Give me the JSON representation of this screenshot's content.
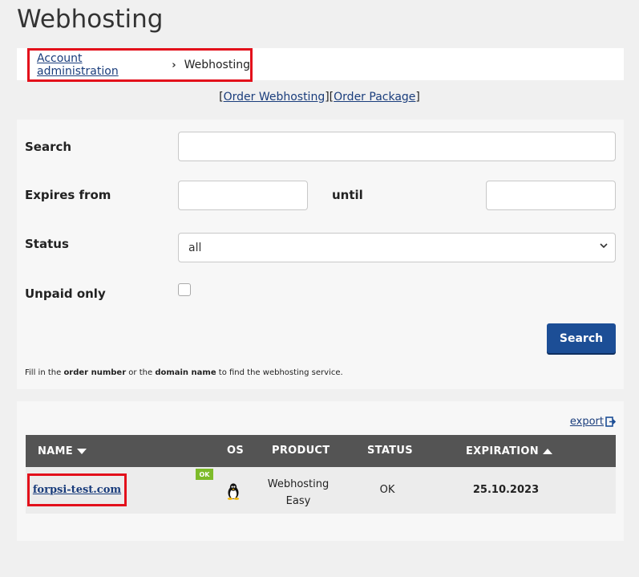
{
  "page": {
    "title": "Webhosting"
  },
  "breadcrumb": {
    "parent": "Account administration",
    "separator": "›",
    "current": "Webhosting"
  },
  "order_links": {
    "open1": "[",
    "order_webhosting": "Order Webhosting",
    "mid": "][",
    "order_package": "Order Package",
    "close": "]"
  },
  "filter": {
    "search_label": "Search",
    "search_value": "",
    "expires_from_label": "Expires from",
    "expires_from_value": "",
    "until_label": "until",
    "until_value": "",
    "status_label": "Status",
    "status_selected": "all",
    "unpaid_label": "Unpaid only",
    "unpaid_checked": false,
    "search_button": "Search",
    "hint_pre": "Fill in the ",
    "hint_b1": "order number",
    "hint_mid": " or the ",
    "hint_b2": "domain name",
    "hint_post": " to find the webhosting service."
  },
  "results": {
    "export_label": "export",
    "columns": {
      "name": "NAME",
      "os": "OS",
      "product": "PRODUCT",
      "status": "STATUS",
      "expiration": "EXPIRATION"
    },
    "rows": [
      {
        "name": "forpsi-test.com",
        "badge": "OK",
        "os_icon": "linux-tux-icon",
        "product_line1": "Webhosting",
        "product_line2": "Easy",
        "status": "OK",
        "expiration": "25.10.2023"
      }
    ]
  },
  "colors": {
    "accent": "#1c4e96",
    "highlight": "#e3101b",
    "header_bg": "#545454",
    "ok_badge": "#7dbb2a"
  }
}
